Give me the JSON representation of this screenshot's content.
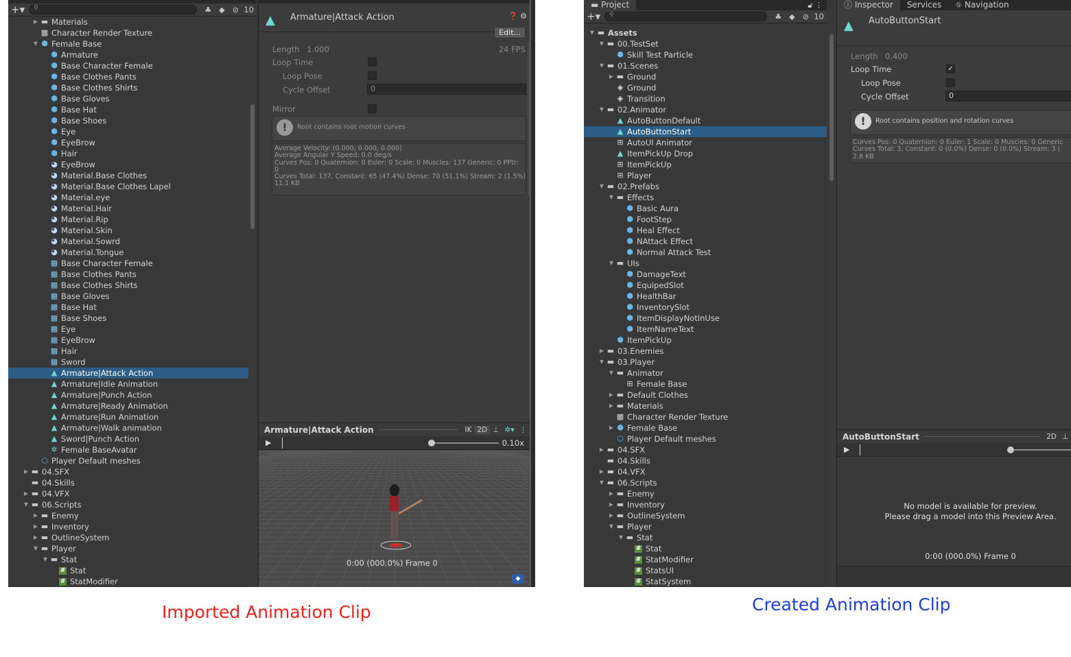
{
  "left": {
    "project": {
      "search_count": "10",
      "rows": [
        {
          "indent": 2,
          "arrow": "▶",
          "icon": "folder",
          "label": "Materials"
        },
        {
          "indent": 2,
          "arrow": "",
          "icon": "rendertex",
          "label": "Character Render Texture"
        },
        {
          "indent": 2,
          "arrow": "▼",
          "icon": "prefab",
          "label": "Female Base"
        },
        {
          "indent": 3,
          "arrow": "",
          "icon": "prefab",
          "label": "Armature"
        },
        {
          "indent": 3,
          "arrow": "",
          "icon": "prefab",
          "label": "Base Character Female"
        },
        {
          "indent": 3,
          "arrow": "",
          "icon": "prefab",
          "label": "Base Clothes Pants"
        },
        {
          "indent": 3,
          "arrow": "",
          "icon": "prefab",
          "label": "Base Clothes Shirts"
        },
        {
          "indent": 3,
          "arrow": "",
          "icon": "prefab",
          "label": "Base Gloves"
        },
        {
          "indent": 3,
          "arrow": "",
          "icon": "prefab",
          "label": "Base Hat"
        },
        {
          "indent": 3,
          "arrow": "",
          "icon": "prefab",
          "label": "Base Shoes"
        },
        {
          "indent": 3,
          "arrow": "",
          "icon": "prefab",
          "label": "Eye"
        },
        {
          "indent": 3,
          "arrow": "",
          "icon": "prefab",
          "label": "EyeBrow"
        },
        {
          "indent": 3,
          "arrow": "",
          "icon": "prefab",
          "label": "Hair"
        },
        {
          "indent": 3,
          "arrow": "",
          "icon": "material",
          "label": "EyeBrow"
        },
        {
          "indent": 3,
          "arrow": "",
          "icon": "material",
          "label": "Material.Base Clothes"
        },
        {
          "indent": 3,
          "arrow": "",
          "icon": "material",
          "label": "Material.Base Clothes Lapel"
        },
        {
          "indent": 3,
          "arrow": "",
          "icon": "material",
          "label": "Material.eye"
        },
        {
          "indent": 3,
          "arrow": "",
          "icon": "material",
          "label": "Material.Hair"
        },
        {
          "indent": 3,
          "arrow": "",
          "icon": "material",
          "label": "Material.Rip"
        },
        {
          "indent": 3,
          "arrow": "",
          "icon": "material",
          "label": "Material.Skin"
        },
        {
          "indent": 3,
          "arrow": "",
          "icon": "material",
          "label": "Material.Sowrd"
        },
        {
          "indent": 3,
          "arrow": "",
          "icon": "material",
          "label": "Material.Tongue"
        },
        {
          "indent": 3,
          "arrow": "",
          "icon": "mesh",
          "label": "Base Character Female"
        },
        {
          "indent": 3,
          "arrow": "",
          "icon": "mesh",
          "label": "Base Clothes Pants"
        },
        {
          "indent": 3,
          "arrow": "",
          "icon": "mesh",
          "label": "Base Clothes Shirts"
        },
        {
          "indent": 3,
          "arrow": "",
          "icon": "mesh",
          "label": "Base Gloves"
        },
        {
          "indent": 3,
          "arrow": "",
          "icon": "mesh",
          "label": "Base Hat"
        },
        {
          "indent": 3,
          "arrow": "",
          "icon": "mesh",
          "label": "Base Shoes"
        },
        {
          "indent": 3,
          "arrow": "",
          "icon": "mesh",
          "label": "Eye"
        },
        {
          "indent": 3,
          "arrow": "",
          "icon": "mesh",
          "label": "EyeBrow"
        },
        {
          "indent": 3,
          "arrow": "",
          "icon": "mesh",
          "label": "Hair"
        },
        {
          "indent": 3,
          "arrow": "",
          "icon": "mesh",
          "label": "Sword"
        },
        {
          "indent": 3,
          "arrow": "",
          "icon": "clip",
          "label": "Armature|Attack Action",
          "selected": true
        },
        {
          "indent": 3,
          "arrow": "",
          "icon": "clip",
          "label": "Armature|Idle Animation"
        },
        {
          "indent": 3,
          "arrow": "",
          "icon": "clip",
          "label": "Armature|Punch Action"
        },
        {
          "indent": 3,
          "arrow": "",
          "icon": "clip",
          "label": "Armature|Ready Animation"
        },
        {
          "indent": 3,
          "arrow": "",
          "icon": "clip",
          "label": "Armature|Run Animation"
        },
        {
          "indent": 3,
          "arrow": "",
          "icon": "clip",
          "label": "Armature|Walk animation"
        },
        {
          "indent": 3,
          "arrow": "",
          "icon": "clip",
          "label": "Sword|Punch Action"
        },
        {
          "indent": 3,
          "arrow": "",
          "icon": "avatar",
          "label": "Female BaseAvatar"
        },
        {
          "indent": 2,
          "arrow": "",
          "icon": "prefab-variant",
          "label": "Player Default meshes"
        },
        {
          "indent": 1,
          "arrow": "▶",
          "icon": "folder",
          "label": "04.SFX"
        },
        {
          "indent": 1,
          "arrow": "",
          "icon": "folder",
          "label": "04.Skills"
        },
        {
          "indent": 1,
          "arrow": "▶",
          "icon": "folder",
          "label": "04.VFX"
        },
        {
          "indent": 1,
          "arrow": "▼",
          "icon": "folder-open",
          "label": "06.Scripts"
        },
        {
          "indent": 2,
          "arrow": "▶",
          "icon": "folder",
          "label": "Enemy"
        },
        {
          "indent": 2,
          "arrow": "▶",
          "icon": "folder",
          "label": "Inventory"
        },
        {
          "indent": 2,
          "arrow": "▶",
          "icon": "folder",
          "label": "OutlineSystem"
        },
        {
          "indent": 2,
          "arrow": "▼",
          "icon": "folder-open",
          "label": "Player"
        },
        {
          "indent": 3,
          "arrow": "▼",
          "icon": "folder-open",
          "label": "Stat"
        },
        {
          "indent": 4,
          "arrow": "",
          "icon": "script",
          "label": "Stat"
        },
        {
          "indent": 4,
          "arrow": "",
          "icon": "script",
          "label": "StatModifier"
        }
      ]
    },
    "inspector": {
      "title": "Armature|Attack Action",
      "edit_label": "Edit...",
      "length_label": "Length",
      "length_value": "1.000",
      "fps": "24 FPS",
      "loop_time": "Loop Time",
      "loop_pose": "Loop Pose",
      "cycle_offset": "Cycle Offset",
      "cycle_offset_value": "0",
      "mirror": "Mirror",
      "help_message": "Root contains root motion curves",
      "info_lines": [
        "Average Velocity: (0.000, 0.000, 0.000)",
        "Average Angular Y Speed: 0.0 deg/s",
        "Curves Pos: 0 Quaternion: 0 Euler: 0 Scale: 0 Muscles: 137 Generic: 0 PPtr:",
        "0",
        "Curves Total: 137, Constant: 65 (47.4%) Dense: 70 (51.1%) Stream: 2 (1.5%)",
        "11.1 KB"
      ],
      "preview_title": "Armature|Attack Action",
      "preview_ik": "IK",
      "preview_2d": "2D",
      "speed": "0.10x",
      "frame_text": "0:00 (000.0%) Frame 0"
    }
  },
  "right": {
    "tabs": {
      "project": "Project",
      "inspector": "Inspector",
      "services": "Services",
      "navigation": "Navigation"
    },
    "project": {
      "search_count": "10",
      "rows": [
        {
          "indent": 0,
          "arrow": "▼",
          "icon": "folder-open",
          "label": "Assets",
          "bold": true
        },
        {
          "indent": 1,
          "arrow": "▼",
          "icon": "folder-open",
          "label": "00.TestSet"
        },
        {
          "indent": 2,
          "arrow": "",
          "icon": "prefab",
          "label": "Skill Test Particle"
        },
        {
          "indent": 1,
          "arrow": "▼",
          "icon": "folder-open",
          "label": "01.Scenes"
        },
        {
          "indent": 2,
          "arrow": "▶",
          "icon": "folder",
          "label": "Ground"
        },
        {
          "indent": 2,
          "arrow": "",
          "icon": "scene",
          "label": "Ground"
        },
        {
          "indent": 2,
          "arrow": "",
          "icon": "scene",
          "label": "Transition"
        },
        {
          "indent": 1,
          "arrow": "▼",
          "icon": "folder-open",
          "label": "02.Animator"
        },
        {
          "indent": 2,
          "arrow": "",
          "icon": "clip",
          "label": "AutoButtonDefault"
        },
        {
          "indent": 2,
          "arrow": "",
          "icon": "clip",
          "label": "AutoButtonStart",
          "selected": true
        },
        {
          "indent": 2,
          "arrow": "",
          "icon": "animator",
          "label": "AutoUI Animator"
        },
        {
          "indent": 2,
          "arrow": "",
          "icon": "clip",
          "label": "ItemPickUp Drop"
        },
        {
          "indent": 2,
          "arrow": "",
          "icon": "animator",
          "label": "ItemPickUp"
        },
        {
          "indent": 2,
          "arrow": "",
          "icon": "animator",
          "label": "Player"
        },
        {
          "indent": 1,
          "arrow": "▼",
          "icon": "folder-open",
          "label": "02.Prefabs"
        },
        {
          "indent": 2,
          "arrow": "▼",
          "icon": "folder-open",
          "label": "Effects"
        },
        {
          "indent": 3,
          "arrow": "",
          "icon": "prefab",
          "label": "Basic Aura"
        },
        {
          "indent": 3,
          "arrow": "",
          "icon": "prefab",
          "label": "FootStep"
        },
        {
          "indent": 3,
          "arrow": "",
          "icon": "prefab",
          "label": "Heal Effect"
        },
        {
          "indent": 3,
          "arrow": "",
          "icon": "prefab",
          "label": "NAttack Effect"
        },
        {
          "indent": 3,
          "arrow": "",
          "icon": "prefab",
          "label": "Normal Attack Test"
        },
        {
          "indent": 2,
          "arrow": "▼",
          "icon": "folder-open",
          "label": "UIs"
        },
        {
          "indent": 3,
          "arrow": "",
          "icon": "prefab",
          "label": "DamageText"
        },
        {
          "indent": 3,
          "arrow": "",
          "icon": "prefab",
          "label": "EquipedSlot"
        },
        {
          "indent": 3,
          "arrow": "",
          "icon": "prefab",
          "label": "HealthBar"
        },
        {
          "indent": 3,
          "arrow": "",
          "icon": "prefab",
          "label": "InventorySlot"
        },
        {
          "indent": 3,
          "arrow": "",
          "icon": "prefab",
          "label": "ItemDisplayNotInUse"
        },
        {
          "indent": 3,
          "arrow": "",
          "icon": "prefab",
          "label": "ItemNameText"
        },
        {
          "indent": 2,
          "arrow": "",
          "icon": "prefab",
          "label": "ItemPickUp"
        },
        {
          "indent": 1,
          "arrow": "▶",
          "icon": "folder",
          "label": "03.Enemies"
        },
        {
          "indent": 1,
          "arrow": "▼",
          "icon": "folder-open",
          "label": "03.Player"
        },
        {
          "indent": 2,
          "arrow": "▼",
          "icon": "folder-open",
          "label": "Animator"
        },
        {
          "indent": 3,
          "arrow": "",
          "icon": "animator",
          "label": "Female Base"
        },
        {
          "indent": 2,
          "arrow": "▶",
          "icon": "folder",
          "label": "Default Clothes"
        },
        {
          "indent": 2,
          "arrow": "▶",
          "icon": "folder",
          "label": "Materials"
        },
        {
          "indent": 2,
          "arrow": "",
          "icon": "rendertex",
          "label": "Character Render Texture"
        },
        {
          "indent": 2,
          "arrow": "▶",
          "icon": "prefab",
          "label": "Female Base"
        },
        {
          "indent": 2,
          "arrow": "",
          "icon": "prefab-variant",
          "label": "Player Default meshes"
        },
        {
          "indent": 1,
          "arrow": "▶",
          "icon": "folder",
          "label": "04.SFX"
        },
        {
          "indent": 1,
          "arrow": "",
          "icon": "folder",
          "label": "04.Skills"
        },
        {
          "indent": 1,
          "arrow": "▶",
          "icon": "folder",
          "label": "04.VFX"
        },
        {
          "indent": 1,
          "arrow": "▼",
          "icon": "folder-open",
          "label": "06.Scripts"
        },
        {
          "indent": 2,
          "arrow": "▶",
          "icon": "folder",
          "label": "Enemy"
        },
        {
          "indent": 2,
          "arrow": "▶",
          "icon": "folder",
          "label": "Inventory"
        },
        {
          "indent": 2,
          "arrow": "▶",
          "icon": "folder",
          "label": "OutlineSystem"
        },
        {
          "indent": 2,
          "arrow": "▼",
          "icon": "folder-open",
          "label": "Player"
        },
        {
          "indent": 3,
          "arrow": "▼",
          "icon": "folder-open",
          "label": "Stat"
        },
        {
          "indent": 4,
          "arrow": "",
          "icon": "script",
          "label": "Stat"
        },
        {
          "indent": 4,
          "arrow": "",
          "icon": "script",
          "label": "StatModifier"
        },
        {
          "indent": 4,
          "arrow": "",
          "icon": "script",
          "label": "StatsUI"
        },
        {
          "indent": 4,
          "arrow": "",
          "icon": "script",
          "label": "StatSystem"
        }
      ]
    },
    "inspector": {
      "title": "AutoButtonStart",
      "length_label": "Length",
      "length_value": "0.400",
      "loop_time": "Loop Time",
      "loop_time_checked": "✓",
      "loop_pose": "Loop Pose",
      "cycle_offset": "Cycle Offset",
      "cycle_offset_value": "0",
      "help_message": "Root contains position and rotation curves",
      "info_lines": [
        "Curves Pos: 0 Quaternion: 0 Euler: 1 Scale: 0 Muscles: 0 Generic",
        "Curves Total: 3, Constant: 0 (0.0%) Dense: 0 (0.0%) Stream: 3 (",
        "2.8 KB"
      ],
      "preview_title": "AutoButtonStart",
      "preview_2d": "2D",
      "no_model_1": "No model is available for preview.",
      "no_model_2": "Please drag a model into this Preview Area.",
      "frame_text": "0:00 (000.0%) Frame 0"
    }
  },
  "captions": {
    "left": "Imported Animation Clip",
    "left_color": "#e8211d",
    "right": "Created Animation Clip",
    "right_color": "#1f3fd6"
  },
  "icons": {
    "folder": "▬",
    "folder-open": "▬",
    "prefab": "⬢",
    "prefab-variant": "⬡",
    "material": "◕",
    "mesh": "▦",
    "clip": "▲",
    "avatar": "✲",
    "script": "#",
    "animator": "⊞",
    "scene": "◈",
    "rendertex": "▩"
  }
}
